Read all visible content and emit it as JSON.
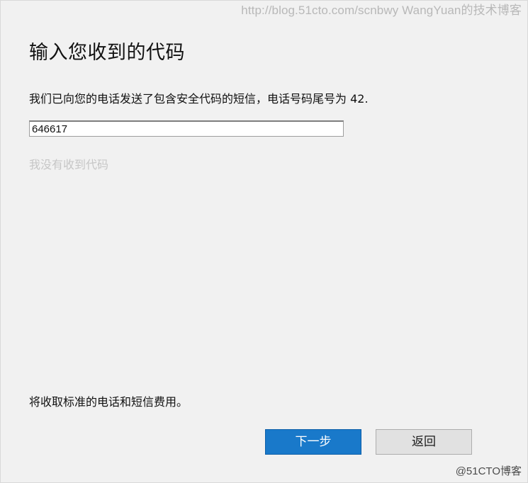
{
  "watermarks": {
    "top": "http://blog.51cto.com/scnbwy WangYuan的技术博客",
    "bottom": "@51CTO博客"
  },
  "dialog": {
    "title": "输入您收到的代码",
    "instruction": "我们已向您的电话发送了包含安全代码的短信，电话号码尾号为 42.",
    "code_input_value": "646617",
    "no_code_link": "我没有收到代码",
    "fee_note": "将收取标准的电话和短信费用。"
  },
  "buttons": {
    "next_label": "下一步",
    "back_label": "返回"
  },
  "colors": {
    "background": "#f1f1f1",
    "primary": "#1979ca",
    "link_disabled": "#c6c6c6"
  }
}
